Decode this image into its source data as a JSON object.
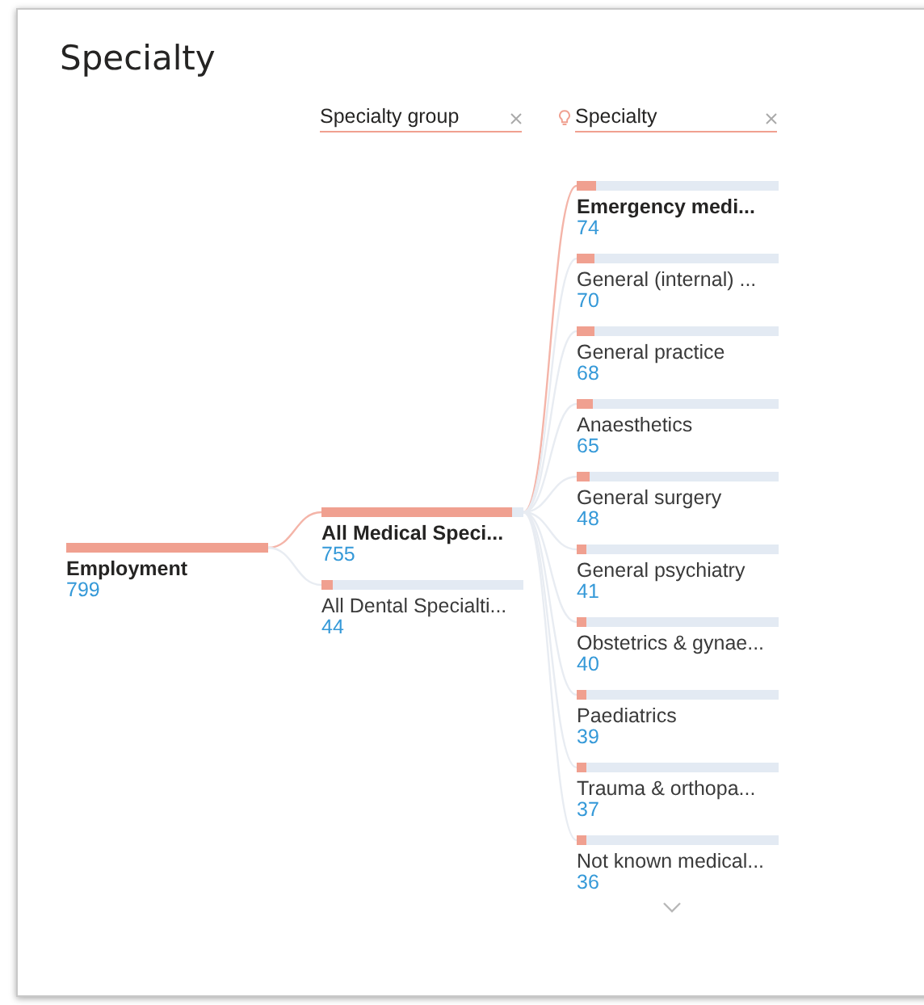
{
  "title": "Specialty",
  "headers": [
    {
      "label": "Specialty group",
      "insight": false
    },
    {
      "label": "Specialty",
      "insight": true
    }
  ],
  "root": {
    "name": "Employment",
    "value": "799",
    "level": 1
  },
  "level_1": [
    {
      "name": "All Medical Speci...",
      "value": "755",
      "level": 0.945,
      "selected": true
    },
    {
      "name": "All Dental Specialti...",
      "value": "44",
      "level": 0.055,
      "selected": false
    }
  ],
  "level_2": [
    {
      "name": "Emergency medi...",
      "value": "74",
      "level": 0.093,
      "selected": true
    },
    {
      "name": "General (internal) ...",
      "value": "70",
      "level": 0.088,
      "selected": false
    },
    {
      "name": "General practice",
      "value": "68",
      "level": 0.085,
      "selected": false
    },
    {
      "name": "Anaesthetics",
      "value": "65",
      "level": 0.081,
      "selected": false
    },
    {
      "name": "General surgery",
      "value": "48",
      "level": 0.06,
      "selected": false
    },
    {
      "name": "General psychiatry",
      "value": "41",
      "level": 0.051,
      "selected": false
    },
    {
      "name": "Obstetrics & gynae...",
      "value": "40",
      "level": 0.05,
      "selected": false
    },
    {
      "name": "Paediatrics",
      "value": "39",
      "level": 0.049,
      "selected": false
    },
    {
      "name": "Trauma & orthopa...",
      "value": "37",
      "level": 0.046,
      "selected": false
    },
    {
      "name": "Not known medical...",
      "value": "36",
      "level": 0.045,
      "selected": false
    }
  ]
}
